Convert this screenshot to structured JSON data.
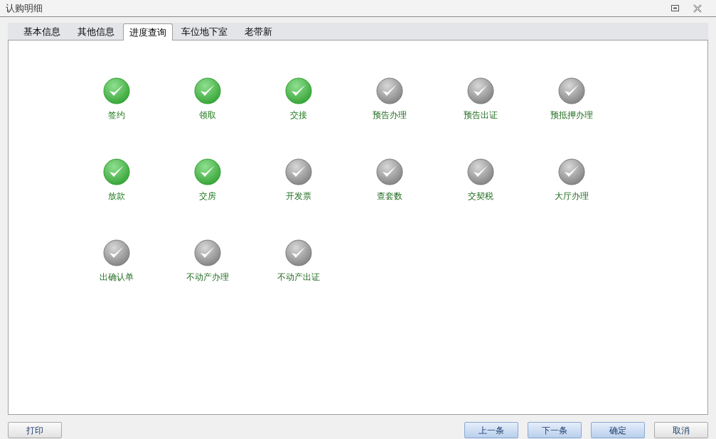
{
  "window": {
    "title": "认购明细"
  },
  "tabs": [
    {
      "label": "基本信息",
      "selected": false
    },
    {
      "label": "其他信息",
      "selected": false
    },
    {
      "label": "进度查询",
      "selected": true
    },
    {
      "label": "车位地下室",
      "selected": false
    },
    {
      "label": "老带新",
      "selected": false
    }
  ],
  "steps": [
    [
      {
        "label": "签约",
        "done": true
      },
      {
        "label": "领取",
        "done": true
      },
      {
        "label": "交接",
        "done": true
      },
      {
        "label": "预告办理",
        "done": false
      },
      {
        "label": "预告出证",
        "done": false
      },
      {
        "label": "预抵押办理",
        "done": false
      }
    ],
    [
      {
        "label": "放款",
        "done": true
      },
      {
        "label": "交房",
        "done": true
      },
      {
        "label": "开发票",
        "done": false
      },
      {
        "label": "查套数",
        "done": false
      },
      {
        "label": "交契税",
        "done": false
      },
      {
        "label": "大厅办理",
        "done": false
      }
    ],
    [
      {
        "label": "出确认单",
        "done": false
      },
      {
        "label": "不动产办理",
        "done": false
      },
      {
        "label": "不动产出证",
        "done": false
      }
    ]
  ],
  "left_buttons": [
    "打印"
  ],
  "right_buttons": [
    "上一条",
    "下一条",
    "确定",
    "取消"
  ]
}
